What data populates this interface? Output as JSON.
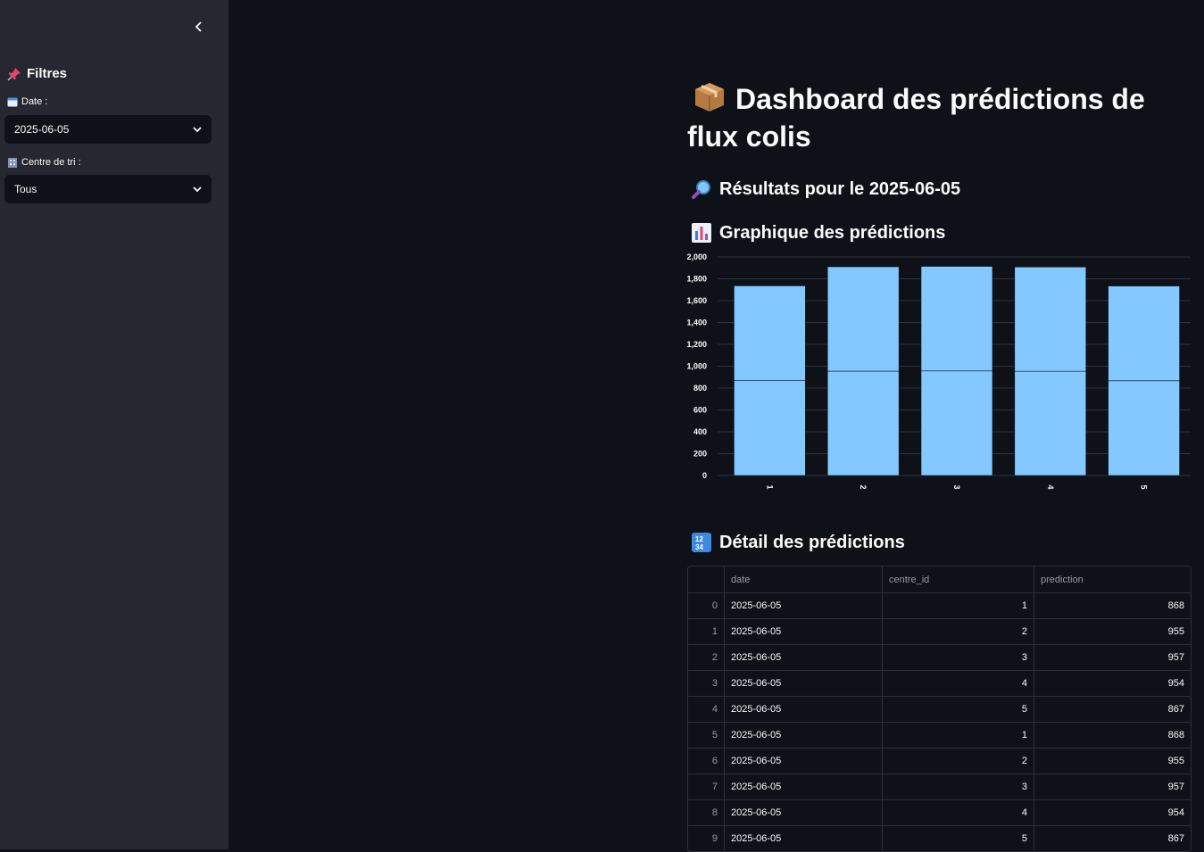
{
  "sidebar": {
    "header": "Filtres",
    "date_label": "Date :",
    "date_value": "2025-06-05",
    "centre_label": "Centre de tri :",
    "centre_value": "Tous"
  },
  "main": {
    "title": "Dashboard des prédictions de flux colis",
    "results_heading": "Résultats pour le 2025-06-05",
    "chart_heading": "Graphique des prédictions",
    "table_heading": "Détail des prédictions"
  },
  "chart_data": {
    "type": "bar",
    "categories": [
      "1",
      "2",
      "3",
      "4",
      "5"
    ],
    "series": [
      {
        "values": [
          868,
          955,
          957,
          954,
          867
        ]
      },
      {
        "values": [
          868,
          955,
          957,
          954,
          867
        ]
      }
    ],
    "stacked": true,
    "ylim": [
      0,
      2000
    ],
    "yticks": [
      "0",
      "200",
      "400",
      "600",
      "800",
      "1,000",
      "1,200",
      "1,400",
      "1,600",
      "1,800",
      "2,000"
    ],
    "grid": true,
    "color": "#83c9ff"
  },
  "table": {
    "columns": [
      "",
      "date",
      "centre_id",
      "prediction"
    ],
    "rows": [
      [
        "0",
        "2025-06-05",
        "1",
        "868"
      ],
      [
        "1",
        "2025-06-05",
        "2",
        "955"
      ],
      [
        "2",
        "2025-06-05",
        "3",
        "957"
      ],
      [
        "3",
        "2025-06-05",
        "4",
        "954"
      ],
      [
        "4",
        "2025-06-05",
        "5",
        "867"
      ],
      [
        "5",
        "2025-06-05",
        "1",
        "868"
      ],
      [
        "6",
        "2025-06-05",
        "2",
        "955"
      ],
      [
        "7",
        "2025-06-05",
        "3",
        "957"
      ],
      [
        "8",
        "2025-06-05",
        "4",
        "954"
      ],
      [
        "9",
        "2025-06-05",
        "5",
        "867"
      ]
    ]
  }
}
